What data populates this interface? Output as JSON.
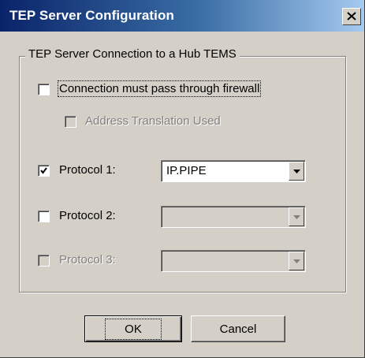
{
  "window": {
    "title": "TEP Server Configuration",
    "close_glyph": "✕"
  },
  "group": {
    "legend": "TEP Server Connection to a Hub TEMS"
  },
  "options": {
    "firewall": {
      "label": "Connection must pass through firewall",
      "checked": false,
      "enabled": true
    },
    "address_translation": {
      "label": "Address Translation Used",
      "checked": false,
      "enabled": false
    }
  },
  "protocols": [
    {
      "label": "Protocol 1:",
      "checked": true,
      "enabled": true,
      "value": "IP.PIPE",
      "combo_enabled": true
    },
    {
      "label": "Protocol 2:",
      "checked": false,
      "enabled": true,
      "value": "",
      "combo_enabled": false
    },
    {
      "label": "Protocol 3:",
      "checked": false,
      "enabled": false,
      "value": "",
      "combo_enabled": false
    }
  ],
  "buttons": {
    "ok": "OK",
    "cancel": "Cancel"
  },
  "colors": {
    "dialog_face": "#d4d0c8",
    "title_gradient_start": "#0a246a",
    "title_gradient_end": "#a6caf0",
    "disabled_text": "#808080"
  }
}
